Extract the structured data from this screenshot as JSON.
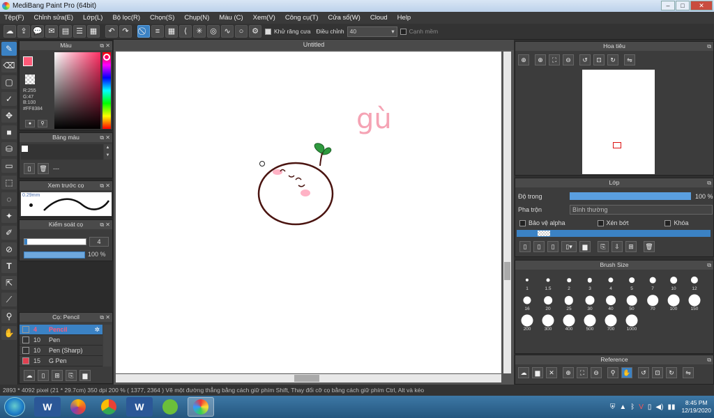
{
  "window": {
    "title": "MediBang Paint Pro (64bit)"
  },
  "menu": [
    "Tệp(F)",
    "Chỉnh sửa(E)",
    "Lớp(L)",
    "Bộ lọc(R)",
    "Chọn(S)",
    "Chụp(N)",
    "Màu (C)",
    "Xem(V)",
    "Công cụ(T)",
    "Cửa sổ(W)",
    "Cloud",
    "Help"
  ],
  "toolbar": {
    "antialias_label": "Khử răng cưa",
    "correction_label": "Điều chỉnh",
    "correction_value": "40",
    "edge_label": "Cạnh mềm"
  },
  "color_panel": {
    "title": "Màu",
    "r": "R:255",
    "g": "G:47",
    "b": "B:100",
    "hex": "#FF8384",
    "primary_color": "#ff5a78",
    "secondary_color": "#ffffff"
  },
  "palette_panel": {
    "title": "Bảng màu",
    "entry": "---"
  },
  "brush_preview_panel": {
    "title": "Xem trước cọ",
    "size": "0.29mm"
  },
  "brush_control_panel": {
    "title": "Kiểm soát cọ",
    "size_value": "4",
    "opacity_value": "100 %"
  },
  "brush_list_panel": {
    "title": "Cọ: Pencil",
    "items": [
      {
        "num": "4",
        "name": "Pencil",
        "color": "#3b82c4",
        "selected": true
      },
      {
        "num": "10",
        "name": "Pen",
        "color": "#333333"
      },
      {
        "num": "10",
        "name": "Pen (Sharp)",
        "color": "#333333"
      },
      {
        "num": "15",
        "name": "G Pen",
        "color": "#e04050"
      }
    ]
  },
  "canvas": {
    "title": "Untitled",
    "text_scribble": "gù"
  },
  "navigator_panel": {
    "title": "Hoa tiêu"
  },
  "layer_panel": {
    "title": "Lớp",
    "opacity_label": "Độ trong",
    "opacity_value": "100 %",
    "blend_label": "Pha trộn",
    "blend_value": "Bình thường",
    "protect_alpha": "Bảo vệ alpha",
    "clipping": "Xén bớt",
    "lock": "Khóa"
  },
  "brush_size_panel": {
    "title": "Brush Size",
    "sizes": [
      "1",
      "1.5",
      "2",
      "3",
      "4",
      "5",
      "7",
      "10",
      "12",
      "16",
      "20",
      "25",
      "30",
      "40",
      "50",
      "70",
      "100",
      "150",
      "200",
      "300",
      "400",
      "500",
      "700",
      "1000"
    ]
  },
  "reference_panel": {
    "title": "Reference"
  },
  "status": {
    "text": "2893 * 4092 pixel   (21 * 29.7cm)   350 dpi   200 %   ( 1377, 2364 )   Vẽ một đường thẳng bằng cách giữ phím Shift, Thay đổi cỡ cọ bằng cách giữ phím Ctrl, Alt và kéo"
  },
  "taskbar": {
    "time": "8:45 PM",
    "date": "12/19/2020"
  }
}
